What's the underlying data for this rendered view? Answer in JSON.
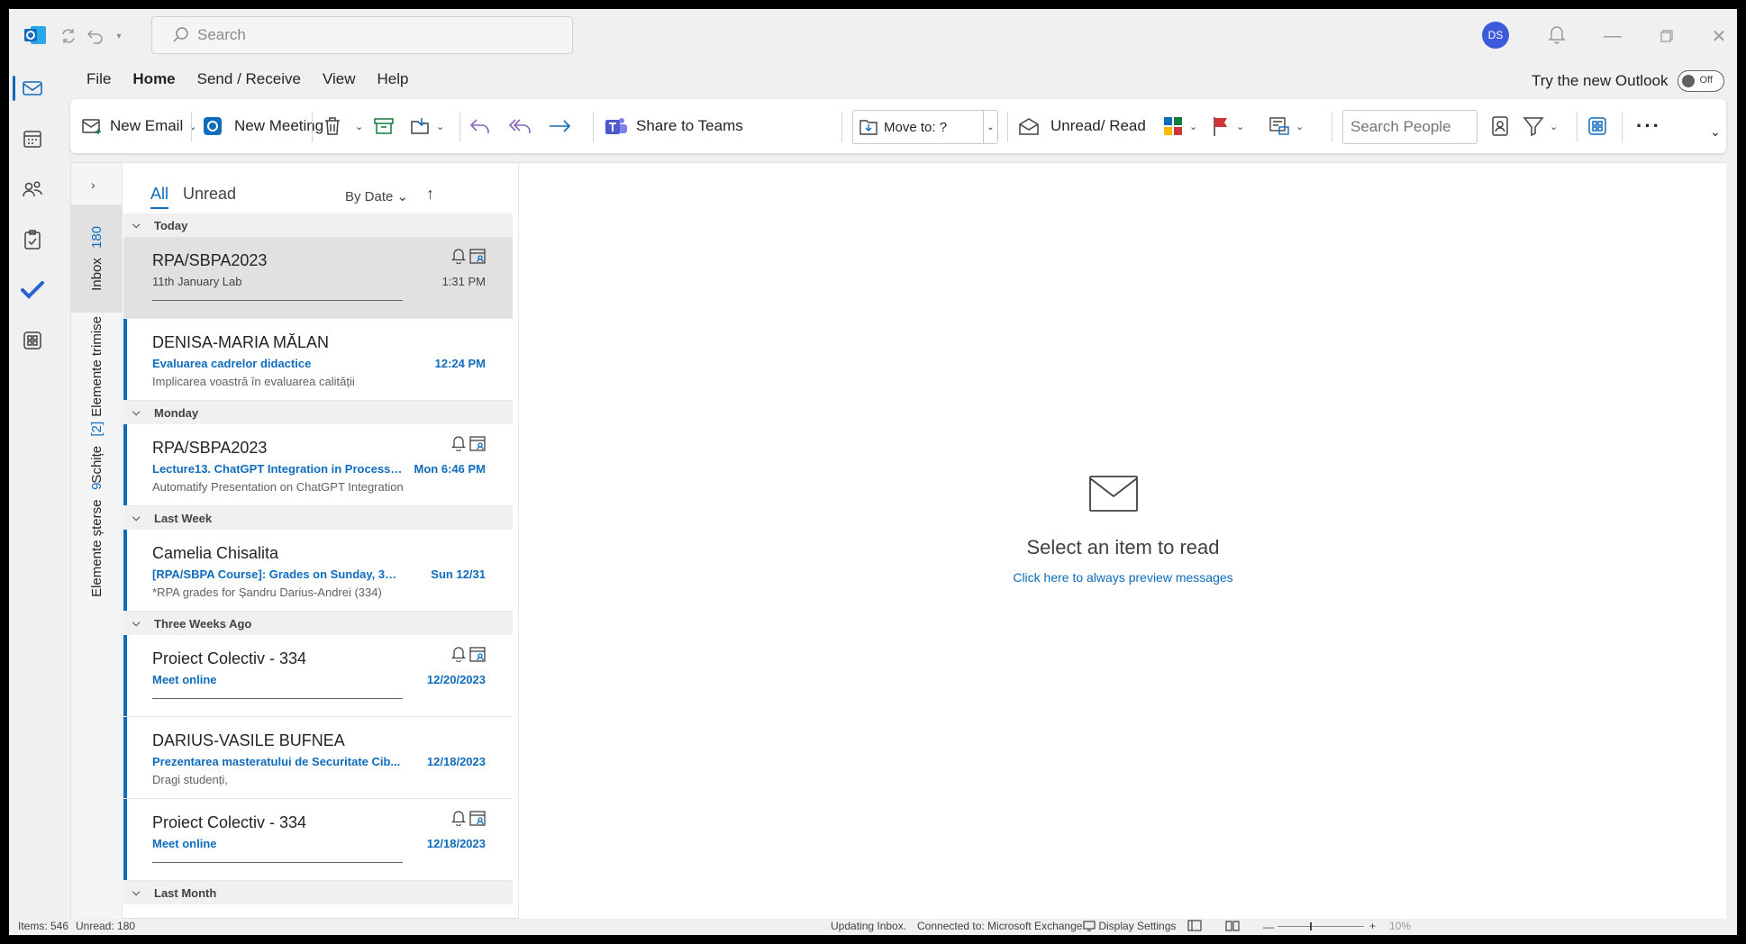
{
  "titlebar": {
    "search_placeholder": "Search",
    "avatar_initials": "DS"
  },
  "ribbon_tabs": [
    "File",
    "Home",
    "Send / Receive",
    "View",
    "Help"
  ],
  "try_new": {
    "label": "Try the new Outlook",
    "toggle_state": "Off"
  },
  "ribbon": {
    "new_email": "New Email",
    "new_meeting": "New Meeting",
    "share_to_teams": "Share to Teams",
    "move_to": "Move to: ?",
    "unread_read": "Unread/ Read",
    "search_people_placeholder": "Search People"
  },
  "folders": [
    {
      "name": "Inbox",
      "count": "180"
    },
    {
      "name": "Elemente trimise",
      "count": ""
    },
    {
      "name": "Schițe",
      "count": "[2]"
    },
    {
      "name": "Elemente șterse",
      "count": "9"
    }
  ],
  "list": {
    "tab_all": "All",
    "tab_unread": "Unread",
    "sort_label": "By Date",
    "groups": [
      {
        "label": "Today",
        "items": [
          {
            "sender": "RPA/SBPA2023",
            "subject": "11th January Lab",
            "preview": "",
            "time": "1:31 PM",
            "unread": false,
            "selected": true,
            "meeting": true
          },
          {
            "sender": "DENISA-MARIA MĂLAN",
            "subject": "Evaluarea cadrelor didactice",
            "preview": "Implicarea voastră în evaluarea calității",
            "time": "12:24 PM",
            "unread": true,
            "selected": false,
            "meeting": false
          }
        ]
      },
      {
        "label": "Monday",
        "items": [
          {
            "sender": "RPA/SBPA2023",
            "subject": "Lecture13. ChatGPT Integration in Process ...",
            "preview": "Automatify Presentation on ChatGPT Integration",
            "time": "Mon 6:46 PM",
            "unread": true,
            "selected": false,
            "meeting": true
          }
        ]
      },
      {
        "label": "Last Week",
        "items": [
          {
            "sender": "Camelia Chisalita",
            "subject": "[RPA/SBPA Course]: Grades on Sunday, 31 ...",
            "preview": "*RPA grades for Șandru Darius-Andrei (334)",
            "time": "Sun 12/31",
            "unread": true,
            "selected": false,
            "meeting": false
          }
        ]
      },
      {
        "label": "Three Weeks Ago",
        "items": [
          {
            "sender": "Proiect Colectiv - 334",
            "subject": "Meet online",
            "preview": "",
            "time": "12/20/2023",
            "unread": true,
            "selected": false,
            "meeting": true
          },
          {
            "sender": "DARIUS-VASILE BUFNEA",
            "subject": "Prezentarea masteratului de Securitate Cib...",
            "preview": "Dragi studenți,",
            "time": "12/18/2023",
            "unread": true,
            "selected": false,
            "meeting": false
          },
          {
            "sender": "Proiect Colectiv - 334",
            "subject": "Meet online",
            "preview": "",
            "time": "12/18/2023",
            "unread": true,
            "selected": false,
            "meeting": true
          }
        ]
      },
      {
        "label": "Last Month",
        "items": []
      }
    ]
  },
  "reading_pane": {
    "title": "Select an item to read",
    "link": "Click here to always preview messages"
  },
  "status": {
    "items": "Items: 546",
    "unread": "Unread: 180",
    "updating": "Updating Inbox.",
    "connected": "Connected to: Microsoft Exchange",
    "display_settings": "Display Settings",
    "zoom": "10%"
  },
  "colors": {
    "accent": "#0f6cbd",
    "flag": "#d13438",
    "archive": "#107c41",
    "reply": "#8764b8"
  }
}
